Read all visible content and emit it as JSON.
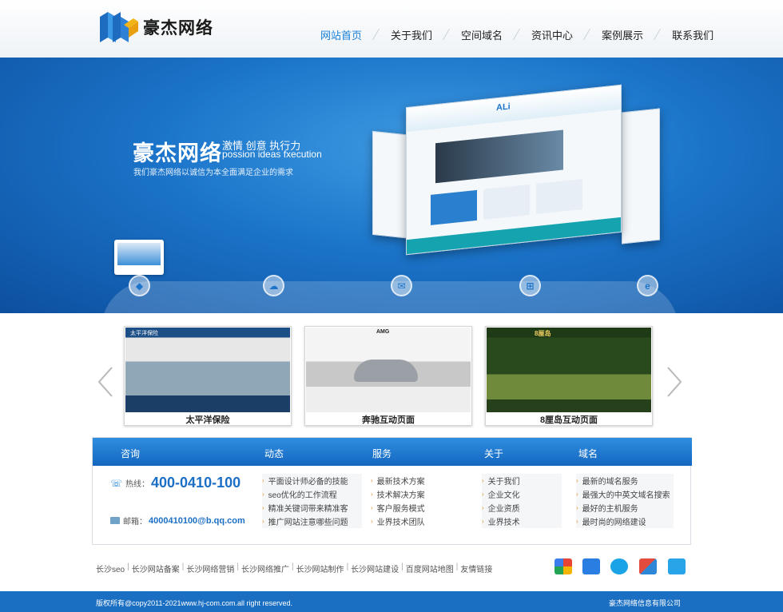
{
  "header": {
    "logo_text": "豪杰网络",
    "nav": [
      {
        "label": "网站首页",
        "active": true
      },
      {
        "label": "关于我们"
      },
      {
        "label": "空间域名"
      },
      {
        "label": "资讯中心"
      },
      {
        "label": "案例展示"
      },
      {
        "label": "联系我们"
      }
    ]
  },
  "banner": {
    "title": "豪杰网络",
    "slogan_cn": "激情 创意 执行力",
    "slogan_en": "possion ideas fxecution",
    "desc": "我们豪杰网络以诚信为本全面满足企业的需求",
    "screen_logo": "ALi"
  },
  "cases": {
    "items": [
      {
        "label": "太平洋保险",
        "img_text": "太平洋保险"
      },
      {
        "label": "奔驰互动页面",
        "img_text": "AMG"
      },
      {
        "label": "8厘岛互动页面",
        "img_text": "8厘岛"
      }
    ]
  },
  "panel": {
    "heads": [
      "咨询",
      "动态",
      "服务",
      "关于",
      "域名"
    ],
    "hotline_label": "热线：",
    "hotline": "400-0410-100",
    "email_label": "邮箱：",
    "email": "4000410100@b.qq.com",
    "news": [
      "平面设计师必备的技能",
      "seo优化的工作流程",
      "精准关键词带来精准客",
      "推广网站注意哪些问题"
    ],
    "services": [
      "最新技术方案",
      "技术解决方案",
      "客户服务模式",
      "业界技术团队"
    ],
    "about": [
      "关于我们",
      "企业文化",
      "企业资质",
      "业界技术"
    ],
    "domains": [
      "最新的域名服务",
      "最强大的中英文域名搜索",
      "最好的主机服务",
      "最时尚的网络建设"
    ]
  },
  "links": [
    "长沙seo",
    "长沙网站备案",
    "长沙网络营销",
    "长沙网络推广",
    "长沙网站制作",
    "长沙网站建设",
    "百度网站地图",
    "友情链接"
  ],
  "footer": {
    "copyright": "版权所有@copy2011-2021www.hj-com.com.all right reserved.",
    "company": "豪杰网络信息有限公司"
  },
  "colors": {
    "brand": "#1b6fc3",
    "accent": "#1a80d9",
    "bullet": "#e09a2a"
  }
}
